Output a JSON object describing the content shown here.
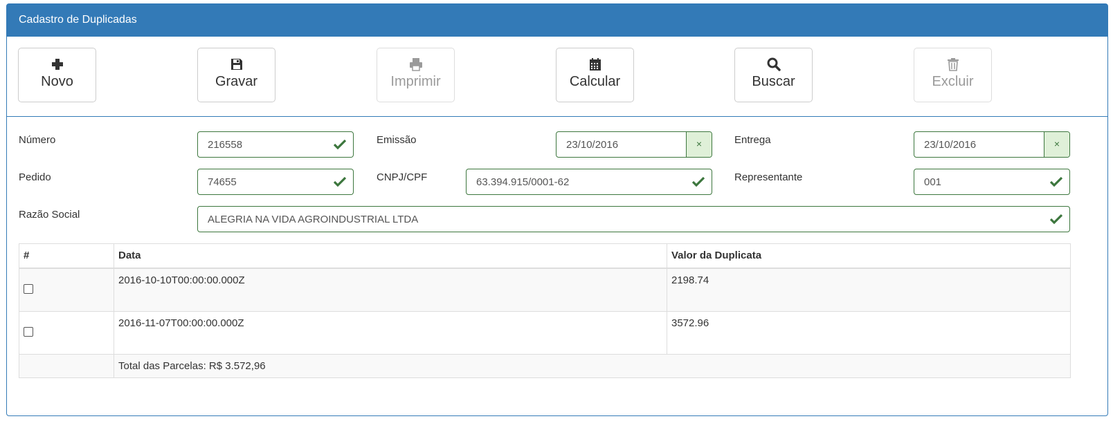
{
  "panel": {
    "title": "Cadastro de Duplicadas"
  },
  "toolbar": {
    "novo": "Novo",
    "gravar": "Gravar",
    "imprimir": "Imprimir",
    "calcular": "Calcular",
    "buscar": "Buscar",
    "excluir": "Excluir"
  },
  "form": {
    "numero": {
      "label": "Número",
      "value": "216558"
    },
    "emissao": {
      "label": "Emissão",
      "value": "23/10/2016",
      "clear": "×"
    },
    "entrega": {
      "label": "Entrega",
      "value": "23/10/2016",
      "clear": "×"
    },
    "pedido": {
      "label": "Pedido",
      "value": "74655"
    },
    "cnpj": {
      "label": "CNPJ/CPF",
      "value": "63.394.915/0001-62"
    },
    "representante": {
      "label": "Representante",
      "value": "001"
    },
    "razao": {
      "label": "Razão Social",
      "value": "ALEGRIA NA VIDA AGROINDUSTRIAL LTDA"
    }
  },
  "table": {
    "headers": [
      "#",
      "Data",
      "Valor da Duplicata"
    ],
    "rows": [
      {
        "data": "2016-10-10T00:00:00.000Z",
        "valor": "2198.74"
      },
      {
        "data": "2016-11-07T00:00:00.000Z",
        "valor": "3572.96"
      }
    ],
    "total": "Total das Parcelas: R$ 3.572,96"
  },
  "colors": {
    "primary": "#337ab7",
    "success": "#3c763d",
    "success_bg": "#dff0d8"
  }
}
